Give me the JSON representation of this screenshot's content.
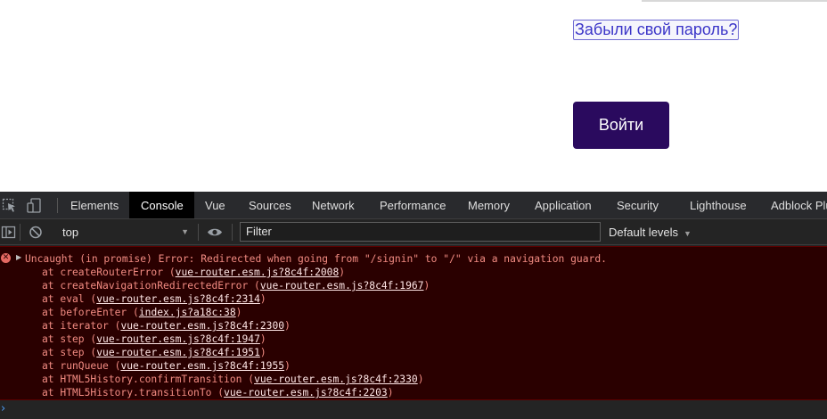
{
  "page": {
    "forgot_password": "Забыли свой пароль?",
    "login_button": "Войти"
  },
  "devtools": {
    "tabs": [
      {
        "label": "Elements",
        "active": false
      },
      {
        "label": "Console",
        "active": true
      },
      {
        "label": "Vue",
        "active": false
      },
      {
        "label": "Sources",
        "active": false
      },
      {
        "label": "Network",
        "active": false
      },
      {
        "label": "Performance",
        "active": false
      },
      {
        "label": "Memory",
        "active": false
      },
      {
        "label": "Application",
        "active": false
      },
      {
        "label": "Security",
        "active": false
      },
      {
        "label": "Lighthouse",
        "active": false
      },
      {
        "label": "Adblock Plu",
        "active": false
      }
    ],
    "toolbar_icons": [
      "inspect-element-icon",
      "device-toolbar-icon"
    ],
    "filterbar": {
      "context": "top",
      "filter_placeholder": "Filter",
      "levels": "Default levels"
    },
    "console": {
      "error": {
        "message": "Uncaught (in promise) Error: Redirected when going from \"/signin\" to \"/\" via a navigation guard.",
        "stack": [
          {
            "fn": "createRouterError",
            "loc": "vue-router.esm.js?8c4f:2008"
          },
          {
            "fn": "createNavigationRedirectedError",
            "loc": "vue-router.esm.js?8c4f:1967"
          },
          {
            "fn": "eval",
            "loc": "vue-router.esm.js?8c4f:2314"
          },
          {
            "fn": "beforeEnter",
            "loc": "index.js?a18c:38"
          },
          {
            "fn": "iterator",
            "loc": "vue-router.esm.js?8c4f:2300"
          },
          {
            "fn": "step",
            "loc": "vue-router.esm.js?8c4f:1947"
          },
          {
            "fn": "step",
            "loc": "vue-router.esm.js?8c4f:1951"
          },
          {
            "fn": "runQueue",
            "loc": "vue-router.esm.js?8c4f:1955"
          },
          {
            "fn": "HTML5History.confirmTransition",
            "loc": "vue-router.esm.js?8c4f:2330"
          },
          {
            "fn": "HTML5History.transitionTo",
            "loc": "vue-router.esm.js?8c4f:2203"
          }
        ]
      },
      "prompt": "›"
    },
    "colors": {
      "login_button": "#2a0a5e",
      "error_text": "#f28b82",
      "error_background": "#2a0000",
      "prompt": "#4d9cf6"
    }
  }
}
